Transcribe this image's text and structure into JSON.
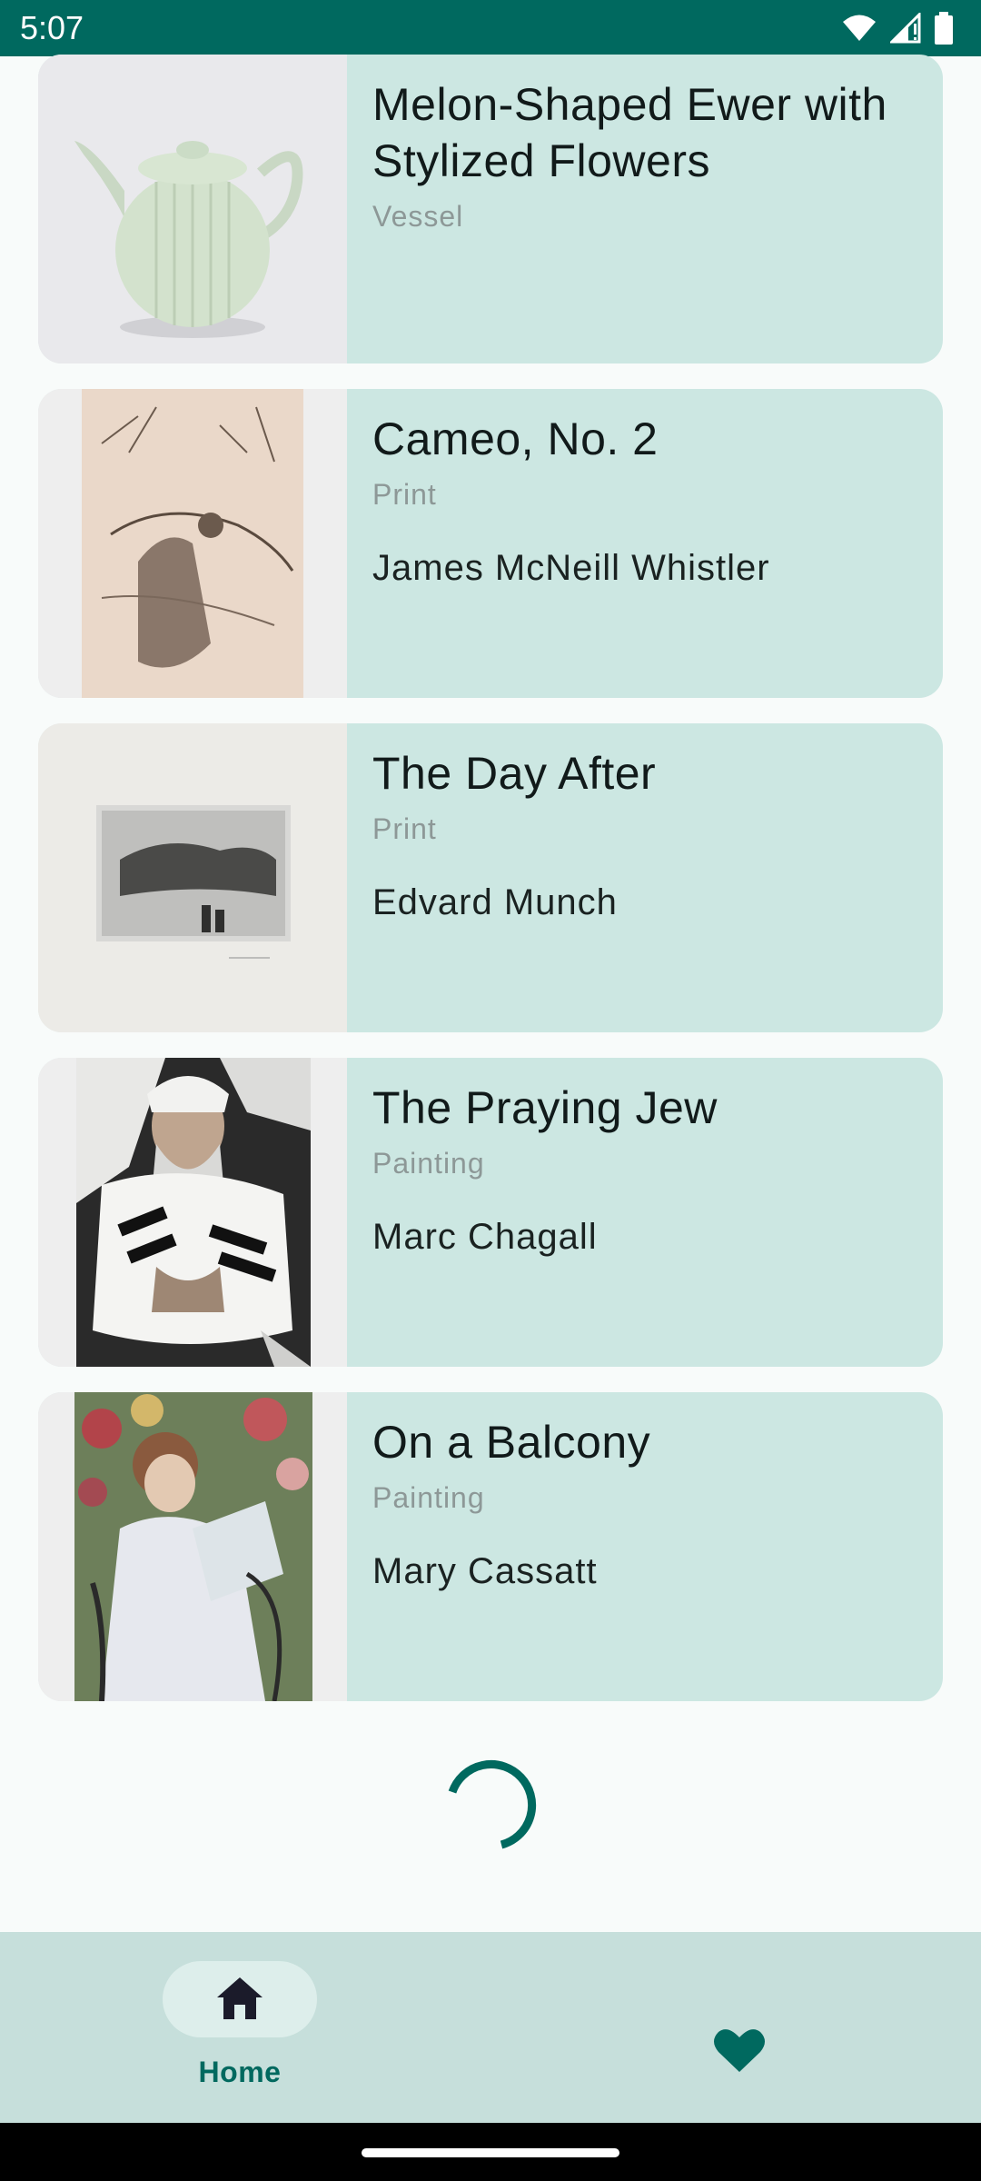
{
  "status_bar": {
    "time": "5:07",
    "icons": [
      "wifi-icon",
      "signal-icon",
      "battery-icon"
    ]
  },
  "artworks": [
    {
      "title": "Melon-Shaped Ewer with Stylized Flowers",
      "type": "Vessel",
      "artist": ""
    },
    {
      "title": "Cameo, No. 2",
      "type": "Print",
      "artist": "James McNeill Whistler"
    },
    {
      "title": "The Day After",
      "type": "Print",
      "artist": "Edvard Munch"
    },
    {
      "title": "The Praying Jew",
      "type": "Painting",
      "artist": "Marc Chagall"
    },
    {
      "title": "On a Balcony",
      "type": "Painting",
      "artist": "Mary Cassatt"
    }
  ],
  "bottom_nav": {
    "home_label": "Home",
    "home_icon": "home-icon",
    "favorites_icon": "heart-icon"
  },
  "colors": {
    "accent": "#00695f",
    "card_bg": "#cce7e2",
    "nav_bg": "#c6dfdb"
  }
}
